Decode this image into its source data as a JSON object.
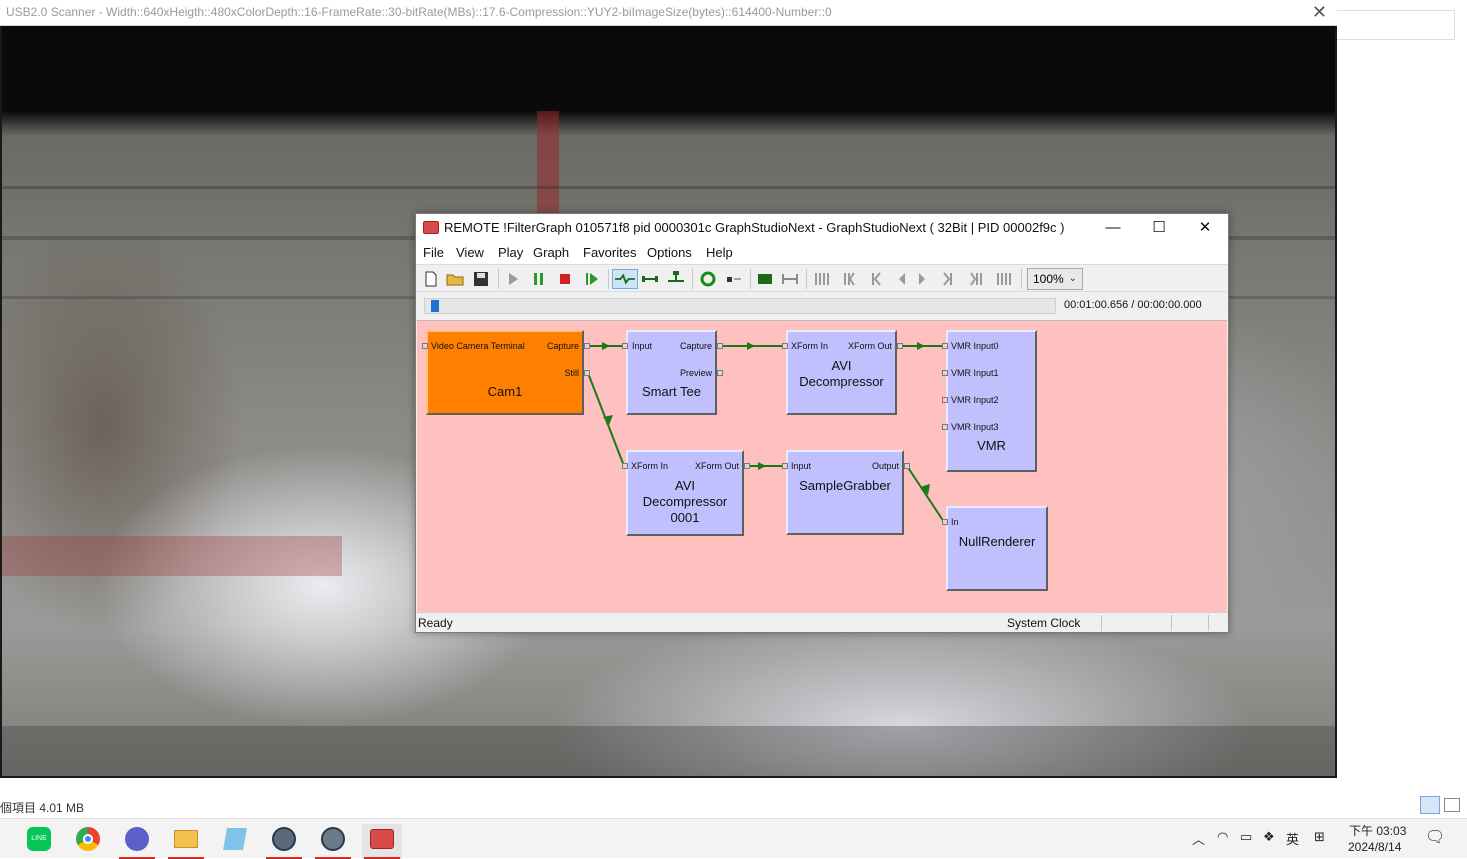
{
  "scanner": {
    "title": "USB2.0 Scanner - Width::640xHeigth::480xColorDepth::16-FrameRate::30-bitRate(MBs)::17.6-Compression::YUY2-biImageSize(bytes)::614400-Number::0",
    "close_glyph": "✕"
  },
  "explorer": {
    "status_text": "個項目  4.01 MB"
  },
  "gsn": {
    "title": "REMOTE !FilterGraph 010571f8 pid 0000301c GraphStudioNext - GraphStudioNext ( 32Bit | PID 00002f9c )",
    "window_buttons": {
      "minimize": "—",
      "maximize": "☐",
      "close": "✕"
    },
    "menu": [
      "File",
      "View",
      "Play",
      "Graph",
      "Favorites",
      "Options",
      "Help"
    ],
    "zoom": "100%",
    "time": "00:01:00.656 / 00:00:00.000",
    "seek_position_fraction": 0.005,
    "status": {
      "ready": "Ready",
      "clock": "System Clock"
    },
    "canvas_color": "#ffc0c0",
    "filters": {
      "cam1": {
        "name": "Cam1",
        "color": "#ff8000",
        "pins_in": [
          "Video Camera Terminal"
        ],
        "pins_out": [
          "Capture",
          "Still"
        ]
      },
      "smart_tee": {
        "name": "Smart Tee",
        "pins_in": [
          "Input"
        ],
        "pins_out": [
          "Capture",
          "Preview"
        ]
      },
      "avi_dec": {
        "name_line1": "AVI",
        "name_line2": "Decompressor",
        "pins_in": [
          "XForm In"
        ],
        "pins_out": [
          "XForm Out"
        ]
      },
      "vmr": {
        "name": "VMR",
        "pins_in": [
          "VMR Input0",
          "VMR Input1",
          "VMR Input2",
          "VMR Input3"
        ]
      },
      "avi_dec_0001": {
        "name_line1": "AVI",
        "name_line2": "Decompressor",
        "name_line3": "0001",
        "pins_in": [
          "XForm In"
        ],
        "pins_out": [
          "XForm Out"
        ]
      },
      "sample_grabber": {
        "name": "SampleGrabber",
        "pins_in": [
          "Input"
        ],
        "pins_out": [
          "Output"
        ]
      },
      "null_renderer": {
        "name": "NullRenderer",
        "pins_in": [
          "In"
        ]
      }
    },
    "filter_color": "#c0c0ff",
    "connection_color": "#1a7a1a"
  },
  "toolbar_icons": [
    "new-icon",
    "open-icon",
    "save-icon",
    "play-icon",
    "pause-icon",
    "stop-icon",
    "step-icon",
    "connect-icon",
    "disconnect-icon",
    "render-icon",
    "refresh-icon",
    "seek-icon",
    "frame-icon",
    "fullscreen-icon",
    "seek-start-icon",
    "seek-back-fast-icon",
    "seek-back-icon",
    "frame-back-icon",
    "frame-forward-icon",
    "seek-forward-icon",
    "seek-forward-fast-icon",
    "seek-end-icon"
  ],
  "taskbar": {
    "icons": [
      "line-icon",
      "chrome-icon",
      "teams-icon",
      "file-explorer-icon",
      "notepad-icon",
      "app-icon",
      "app-icon-2",
      "graphstudio-icon"
    ],
    "ime": "英",
    "clock_time": "下午 03:03",
    "clock_date": "2024/8/14"
  }
}
